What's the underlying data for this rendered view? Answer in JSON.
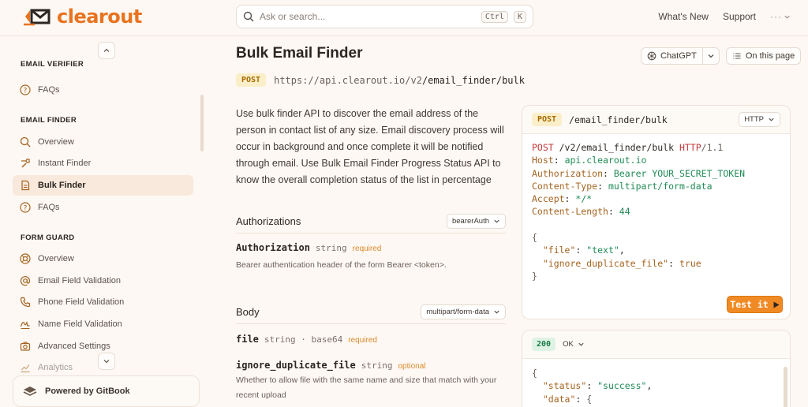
{
  "header": {
    "logo_text": "clearout",
    "search_placeholder": "Ask or search...",
    "shortcut_ctrl": "Ctrl",
    "shortcut_key": "K",
    "nav_whats_new": "What's New",
    "nav_support": "Support",
    "nav_more": "···"
  },
  "sidebar": {
    "sections": [
      {
        "title": "EMAIL VERIFIER"
      },
      {
        "title": "EMAIL FINDER"
      },
      {
        "title": "FORM GUARD"
      }
    ],
    "items": [
      {
        "label": "FAQs",
        "icon": "question-circle-icon"
      },
      {
        "label": "Overview",
        "icon": "search-icon"
      },
      {
        "label": "Instant Finder",
        "icon": "hammer-icon"
      },
      {
        "label": "Bulk Finder",
        "icon": "file-icon",
        "active": true
      },
      {
        "label": "FAQs",
        "icon": "question-circle-icon"
      },
      {
        "label": "Overview",
        "icon": "lifebuoy-icon"
      },
      {
        "label": "Email Field Validation",
        "icon": "at-icon"
      },
      {
        "label": "Phone Field Validation",
        "icon": "phone-icon"
      },
      {
        "label": "Name Field Validation",
        "icon": "signature-icon"
      },
      {
        "label": "Advanced Settings",
        "icon": "camera-icon"
      },
      {
        "label": "Analytics",
        "icon": "chart-icon"
      }
    ],
    "powered_by": "Powered by GitBook"
  },
  "page": {
    "title": "Bulk Email Finder",
    "method": "POST",
    "url_base": "https://api.clearout.io/v2",
    "url_path": "/email_finder/bulk",
    "description": "Use bulk finder API to discover the email address of the person in contact list of any size. Email discovery process will occur in background and once complete it will be notified through email. Use Bulk Email Finder Progress Status API to know the overall completion status of the list in percentage",
    "actions": {
      "chatgpt": "ChatGPT",
      "on_this_page": "On this page"
    },
    "authorizations": {
      "title": "Authorizations",
      "select": "bearerAuth",
      "param_name": "Authorization",
      "param_type": "string",
      "param_flag": "required",
      "param_desc": "Bearer authentication header of the form Bearer <token>."
    },
    "body": {
      "title": "Body",
      "select": "multipart/form-data",
      "params": [
        {
          "name": "file",
          "type": "string · base64",
          "flag": "required",
          "desc": ""
        },
        {
          "name": "ignore_duplicate_file",
          "type": "string",
          "flag": "optional",
          "desc": "Whether to allow file with the same name and size that match with your recent upload"
        }
      ]
    }
  },
  "request_panel": {
    "method": "POST",
    "path": "/email_finder/bulk",
    "lang": "HTTP",
    "line1": {
      "method": "POST",
      "path": " /v2/email_finder/bulk ",
      "proto": "HTTP",
      "ver": "/1.1"
    },
    "headers": [
      {
        "k": "Host",
        "v": "api.clearout.io"
      },
      {
        "k": "Authorization",
        "v": "Bearer YOUR_SECRET_TOKEN"
      },
      {
        "k": "Content-Type",
        "v": "multipart/form-data"
      },
      {
        "k": "Accept",
        "v": "*/*"
      },
      {
        "k": "Content-Length",
        "v": "44"
      }
    ],
    "body_open": "{",
    "body_file_key": "\"file\"",
    "body_file_val": "\"text\"",
    "body_dup_key": "\"ignore_duplicate_file\"",
    "body_dup_val": "true",
    "body_close": "}",
    "test_label": "Test it"
  },
  "response_panel": {
    "status": "200",
    "status_text": "OK",
    "open": "{",
    "status_key": "\"status\"",
    "status_val": "\"success\"",
    "data_key": "\"data\"",
    "data_open": "{"
  },
  "colors": {
    "brand": "#e9731f",
    "accent_button": "#f08a24",
    "active_bg": "#f8e9dc"
  }
}
